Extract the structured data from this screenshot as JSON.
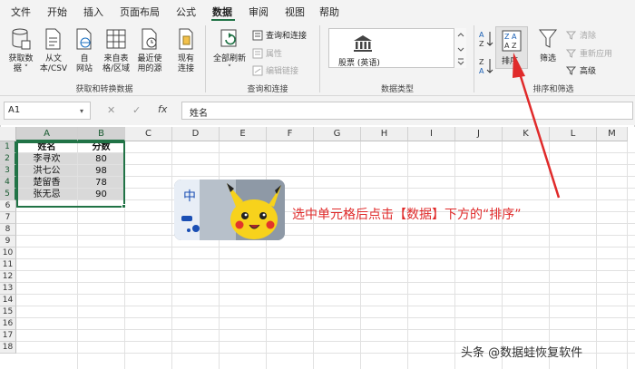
{
  "menu": {
    "items": [
      "文件",
      "开始",
      "插入",
      "页面布局",
      "公式",
      "数据",
      "审阅",
      "视图",
      "帮助"
    ],
    "active": "数据"
  },
  "ribbon": {
    "get_transform": {
      "label": "获取和转换数据",
      "buttons": [
        {
          "line1": "获取数",
          "line2": "据 ˅"
        },
        {
          "line1": "从文",
          "line2": "本/CSV"
        },
        {
          "line1": "自",
          "line2": "网站"
        },
        {
          "line1": "来自表",
          "line2": "格/区域"
        },
        {
          "line1": "最近使",
          "line2": "用的源"
        },
        {
          "line1": "现有",
          "line2": "连接"
        }
      ]
    },
    "queries": {
      "label": "查询和连接",
      "refresh_label": "全部刷新",
      "refresh_arrow": "˅",
      "items": [
        "查询和连接",
        "属性",
        "编辑链接"
      ]
    },
    "data_types": {
      "label": "数据类型",
      "stock_label": "股票 (英语)"
    },
    "sort_filter": {
      "label": "排序和筛选",
      "sort_label": "排序",
      "filter_label": "筛选",
      "items": [
        "清除",
        "重新应用",
        "高级"
      ],
      "az": "A↓Z",
      "za": "Z↓A"
    }
  },
  "formula_bar": {
    "name_box": "A1",
    "fx": "fx",
    "cancel": "✕",
    "confirm": "✓",
    "value": "姓名"
  },
  "sheet": {
    "columns": [
      "A",
      "B",
      "C",
      "D",
      "E",
      "F",
      "G",
      "H",
      "I",
      "J",
      "K",
      "L",
      "M"
    ],
    "rows": [
      "1",
      "2",
      "3",
      "4",
      "5",
      "6",
      "7",
      "8",
      "9",
      "10",
      "11",
      "12",
      "13",
      "14",
      "15",
      "16",
      "17",
      "18"
    ],
    "header": [
      "姓名",
      "分数"
    ],
    "data": [
      [
        "李寻欢",
        "80"
      ],
      [
        "洪七公",
        "98"
      ],
      [
        "楚留香",
        "78"
      ],
      [
        "张无忌",
        "90"
      ]
    ]
  },
  "annotation": "选中单元格后点击【数据】下方的“排序”",
  "watermark": "头条 @数据蛙恢复软件",
  "sticker": {
    "char": "中"
  },
  "colors": {
    "accent": "#217346",
    "annotation": "#e02a2a"
  }
}
